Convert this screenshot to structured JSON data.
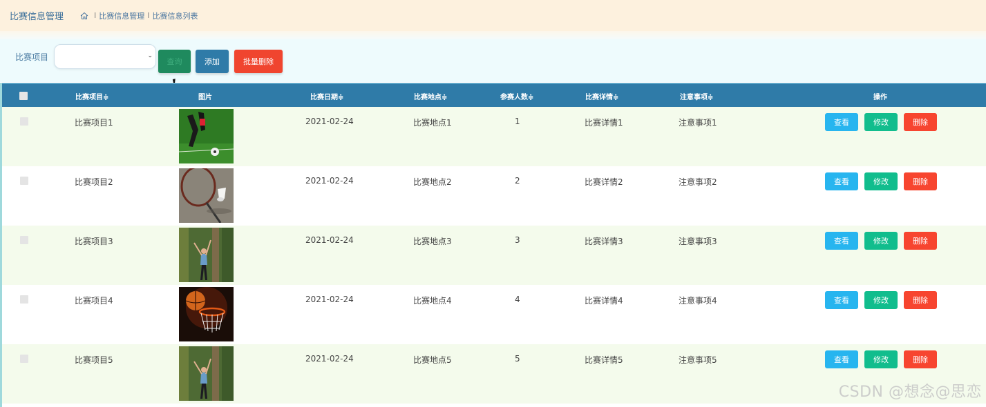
{
  "header": {
    "title": "比赛信息管理",
    "breadcrumb": [
      "比赛信息管理",
      "比赛信息列表"
    ],
    "breadcrumb_sep": "I"
  },
  "toolbar": {
    "filter_label": "比赛项目",
    "filter_value": "",
    "search_label": "查询",
    "add_label": "添加",
    "bulk_delete_label": "批量删除"
  },
  "table": {
    "columns": [
      "比赛项目≑",
      "图片",
      "比赛日期≑",
      "比赛地点≑",
      "参赛人数≑",
      "比赛详情≑",
      "注意事项≑",
      "操作"
    ],
    "rows": [
      {
        "project": "比赛项目1",
        "image": "soccer",
        "date": "2021-02-24",
        "place": "比赛地点1",
        "count": "1",
        "detail": "比赛详情1",
        "notes": "注意事项1"
      },
      {
        "project": "比赛项目2",
        "image": "badminton",
        "date": "2021-02-24",
        "place": "比赛地点2",
        "count": "2",
        "detail": "比赛详情2",
        "notes": "注意事项2"
      },
      {
        "project": "比赛项目3",
        "image": "volleyball",
        "date": "2021-02-24",
        "place": "比赛地点3",
        "count": "3",
        "detail": "比赛详情3",
        "notes": "注意事项3"
      },
      {
        "project": "比赛项目4",
        "image": "basketball",
        "date": "2021-02-24",
        "place": "比赛地点4",
        "count": "4",
        "detail": "比赛详情4",
        "notes": "注意事项4"
      },
      {
        "project": "比赛项目5",
        "image": "volleyball",
        "date": "2021-02-24",
        "place": "比赛地点5",
        "count": "5",
        "detail": "比赛详情5",
        "notes": "注意事项5"
      }
    ],
    "actions": {
      "view": "查看",
      "edit": "修改",
      "delete": "删除"
    }
  },
  "watermark": "CSDN @想念@思恋",
  "colors": {
    "header_bg": "#fdf1de",
    "table_header": "#2f7ba8",
    "row_alt": "#f4fbec",
    "view": "#27b5ef",
    "edit": "#11bd8d",
    "delete": "#f7452f"
  }
}
